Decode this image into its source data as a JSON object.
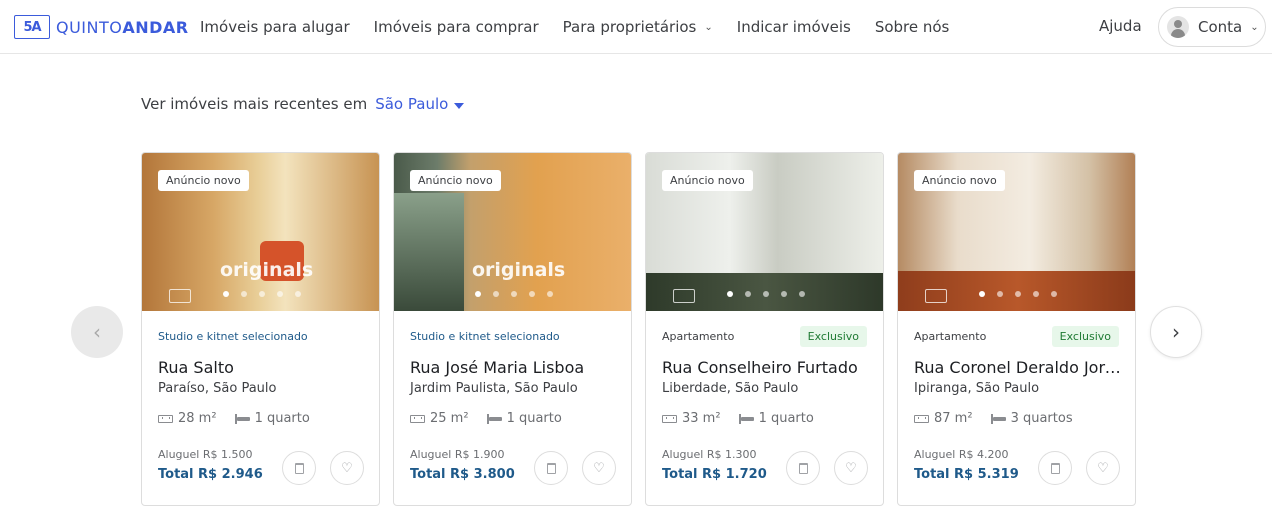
{
  "header": {
    "logo_text_light": "QUINTO",
    "logo_text_bold": "ANDAR",
    "logo_mark": "5A",
    "nav": [
      {
        "label": "Imóveis para alugar"
      },
      {
        "label": "Imóveis para comprar"
      },
      {
        "label": "Para proprietários",
        "dropdown": true
      },
      {
        "label": "Indicar imóveis"
      },
      {
        "label": "Sobre nós"
      }
    ],
    "help_label": "Ajuda",
    "account_label": "Conta"
  },
  "section": {
    "title": "Ver imóveis mais recentes em",
    "city": "São Paulo"
  },
  "colors": {
    "brand_blue": "#3b5bdb",
    "price_blue": "#1f5a8a",
    "exclusive_bg": "#e7f7ea",
    "exclusive_text": "#1f7a33"
  },
  "icons": {
    "prev": "chevron-left-icon",
    "next": "chevron-right-icon",
    "area": "area-icon",
    "bed": "bed-icon",
    "trash": "trash-icon",
    "favorite": "heart-icon"
  },
  "cards": [
    {
      "badge": "Anúncio novo",
      "watermark": "originals",
      "type": "Studio e kitnet selecionado",
      "exclusive": "",
      "street": "Rua Salto",
      "neighborhood": "Paraíso, São Paulo",
      "area": "28 m²",
      "rooms": "1 quarto",
      "rent": "Aluguel R$ 1.500",
      "total": "Total R$ 2.946"
    },
    {
      "badge": "Anúncio novo",
      "watermark": "originals",
      "type": "Studio e kitnet selecionado",
      "exclusive": "",
      "street": "Rua José Maria Lisboa",
      "neighborhood": "Jardim Paulista, São Paulo",
      "area": "25 m²",
      "rooms": "1 quarto",
      "rent": "Aluguel R$ 1.900",
      "total": "Total R$ 3.800"
    },
    {
      "badge": "Anúncio novo",
      "watermark": "",
      "type": "Apartamento",
      "exclusive": "Exclusivo",
      "street": "Rua Conselheiro Furtado",
      "neighborhood": "Liberdade, São Paulo",
      "area": "33 m²",
      "rooms": "1 quarto",
      "rent": "Aluguel R$ 1.300",
      "total": "Total R$ 1.720"
    },
    {
      "badge": "Anúncio novo",
      "watermark": "",
      "type": "Apartamento",
      "exclusive": "Exclusivo",
      "street": "Rua Coronel Deraldo Jord...",
      "neighborhood": "Ipiranga, São Paulo",
      "area": "87 m²",
      "rooms": "3 quartos",
      "rent": "Aluguel R$ 4.200",
      "total": "Total R$ 5.319"
    }
  ]
}
